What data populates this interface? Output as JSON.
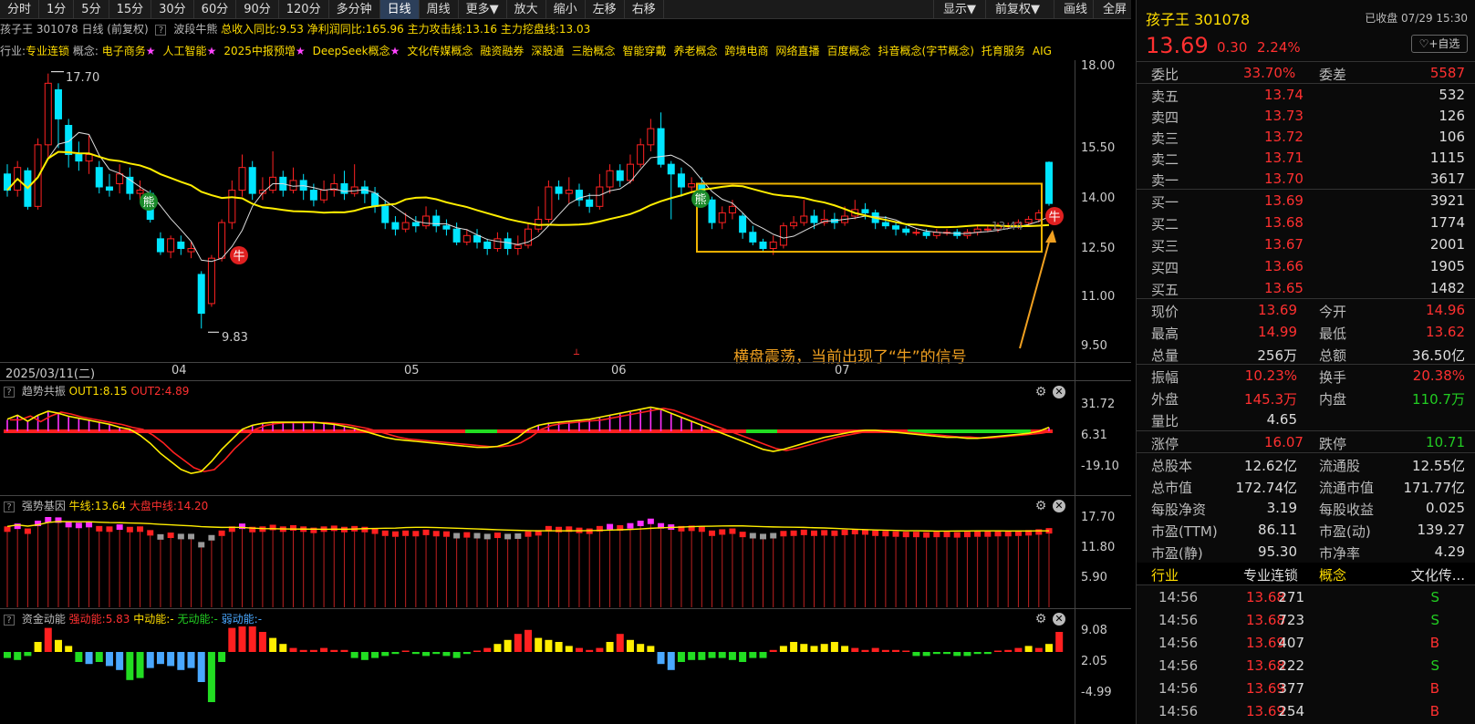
{
  "toolbar": {
    "buttons": [
      "分时",
      "1分",
      "5分",
      "15分",
      "30分",
      "60分",
      "90分",
      "120分",
      "多分钟",
      "日线",
      "周线",
      "更多▼",
      "放大",
      "缩小",
      "左移",
      "右移"
    ],
    "active": "日线",
    "right": [
      "显示▼",
      "前复权▼",
      "画线",
      "全屏"
    ]
  },
  "title_row": {
    "stock": "孩子王 301078 日线",
    "adjust": "(前复权)",
    "indicator": "波段牛熊",
    "fields": [
      "总收入同比:9.53",
      "净利润同比:165.96",
      "主力攻击线:13.16",
      "主力挖盘线:13.03"
    ]
  },
  "industry_row": {
    "industry_label": "行业:",
    "industry": "专业连锁",
    "concept_label": "概念:",
    "tags": [
      {
        "text": "电子商务",
        "star": true
      },
      {
        "text": "人工智能",
        "star": true
      },
      {
        "text": "2025中报预增",
        "star": true
      },
      {
        "text": "DeepSeek概念",
        "star": true
      },
      {
        "text": "文化传媒概念",
        "star": false
      },
      {
        "text": "融资融券",
        "star": false
      },
      {
        "text": "深股通",
        "star": false
      },
      {
        "text": "三胎概念",
        "star": false
      },
      {
        "text": "智能穿戴",
        "star": false
      },
      {
        "text": "养老概念",
        "star": false
      },
      {
        "text": "跨境电商",
        "star": false
      },
      {
        "text": "网络直播",
        "star": false
      },
      {
        "text": "百度概念",
        "star": false
      },
      {
        "text": "抖音概念(字节概念)",
        "star": false
      },
      {
        "text": "托育服务",
        "star": false
      },
      {
        "text": "AIG",
        "star": false
      }
    ],
    "star_char": "★"
  },
  "main_chart": {
    "y_ticks": [
      "18.00",
      "15.50",
      "14.00",
      "12.50",
      "11.00",
      "9.50"
    ],
    "x_ticks": [
      "2025/03/11(二)",
      "04",
      "05",
      "06",
      "07"
    ],
    "high_label": "17.70",
    "low_label": "9.83",
    "price_inline": "13.44",
    "annotation": "横盘震荡，当前出现了“牛”的信号",
    "bull_char": "牛",
    "bear_char": "熊",
    "colors": {
      "up": "#ff2222",
      "down": "#00e5ff",
      "ma_yellow": "#ffee00",
      "ma_white": "#dddddd",
      "box": "#f0b400",
      "annotation": "#f0a020"
    }
  },
  "panel1": {
    "name": "趋势共振",
    "out1": "OUT1:8.15",
    "out2": "OUT2:4.89",
    "y_ticks": [
      "31.72",
      "6.31",
      "-19.10"
    ]
  },
  "panel2": {
    "name": "强势基因",
    "bull_line": "牛线:13.64",
    "market_mid": "大盘中线:14.20",
    "y_ticks": [
      "17.70",
      "11.80",
      "5.90"
    ]
  },
  "panel3": {
    "name": "资金动能",
    "strong": "强动能:5.83",
    "mid": "中动能:-",
    "none": "无动能:-",
    "weak": "弱动能:-",
    "y_ticks": [
      "9.08",
      "2.05",
      "-4.99"
    ]
  },
  "quote": {
    "name": "孩子王 301078",
    "status": "已收盘 07/29 15:30",
    "price": "13.69",
    "change": "0.30",
    "pct": "2.24%",
    "fav_button": "+自选",
    "ratio_label": "委比",
    "ratio": "33.70%",
    "diff_label": "委差",
    "diff": "5587",
    "asks": [
      {
        "label": "卖五",
        "price": "13.74",
        "vol": "532"
      },
      {
        "label": "卖四",
        "price": "13.73",
        "vol": "126"
      },
      {
        "label": "卖三",
        "price": "13.72",
        "vol": "106"
      },
      {
        "label": "卖二",
        "price": "13.71",
        "vol": "1115"
      },
      {
        "label": "卖一",
        "price": "13.70",
        "vol": "3617"
      }
    ],
    "bids": [
      {
        "label": "买一",
        "price": "13.69",
        "vol": "3921"
      },
      {
        "label": "买二",
        "price": "13.68",
        "vol": "1774"
      },
      {
        "label": "买三",
        "price": "13.67",
        "vol": "2001"
      },
      {
        "label": "买四",
        "price": "13.66",
        "vol": "1905"
      },
      {
        "label": "买五",
        "price": "13.65",
        "vol": "1482"
      }
    ],
    "stats1": [
      {
        "l1": "现价",
        "v1": "13.69",
        "c1": "red",
        "l2": "今开",
        "v2": "14.96",
        "c2": "red"
      },
      {
        "l1": "最高",
        "v1": "14.99",
        "c1": "red",
        "l2": "最低",
        "v2": "13.62",
        "c2": "red"
      },
      {
        "l1": "总量",
        "v1": "256万",
        "c1": "white",
        "l2": "总额",
        "v2": "36.50亿",
        "c2": "white"
      }
    ],
    "stats2": [
      {
        "l1": "振幅",
        "v1": "10.23%",
        "c1": "red",
        "l2": "换手",
        "v2": "20.38%",
        "c2": "red"
      },
      {
        "l1": "外盘",
        "v1": "145.3万",
        "c1": "red",
        "l2": "内盘",
        "v2": "110.7万",
        "c2": "green"
      },
      {
        "l1": "量比",
        "v1": "4.65",
        "c1": "white",
        "l2": "",
        "v2": "",
        "c2": "white"
      }
    ],
    "limits": {
      "up_label": "涨停",
      "up": "16.07",
      "down_label": "跌停",
      "down": "10.71"
    },
    "fundamentals": [
      {
        "l1": "总股本",
        "v1": "12.62亿",
        "l2": "流通股",
        "v2": "12.55亿"
      },
      {
        "l1": "总市值",
        "v1": "172.74亿",
        "l2": "流通市值",
        "v2": "171.77亿"
      },
      {
        "l1": "每股净资",
        "v1": "3.19",
        "l2": "每股收益",
        "v2": "0.025"
      },
      {
        "l1": "市盈(TTM)",
        "v1": "86.11",
        "l2": "市盈(动)",
        "v2": "139.27"
      },
      {
        "l1": "市盈(静)",
        "v1": "95.30",
        "l2": "市净率",
        "v2": "4.29"
      }
    ],
    "industry_row": {
      "l1": "行业",
      "v1": "专业连锁",
      "l2": "概念",
      "v2": "文化传..."
    },
    "ticks": [
      {
        "time": "14:56",
        "price": "13.68",
        "vol": "271",
        "side": "S"
      },
      {
        "time": "14:56",
        "price": "13.68",
        "vol": "723",
        "side": "S"
      },
      {
        "time": "14:56",
        "price": "13.69",
        "vol": "407",
        "side": "B"
      },
      {
        "time": "14:56",
        "price": "13.68",
        "vol": "222",
        "side": "S"
      },
      {
        "time": "14:56",
        "price": "13.69",
        "vol": "377",
        "side": "B"
      },
      {
        "time": "14:56",
        "price": "13.69",
        "vol": "254",
        "side": "B"
      }
    ]
  }
}
